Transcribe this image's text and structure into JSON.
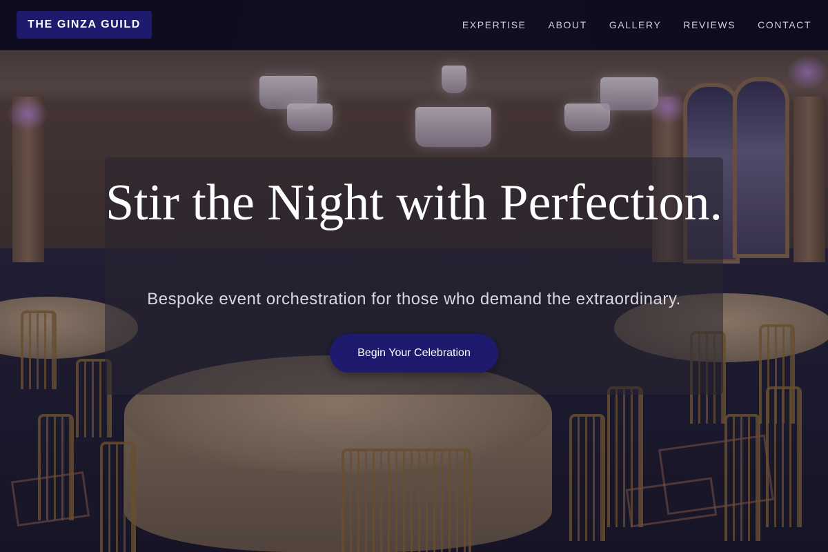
{
  "brand": {
    "name": "THE GINZA GUILD"
  },
  "nav": {
    "links": [
      {
        "label": "EXPERTISE"
      },
      {
        "label": "ABOUT"
      },
      {
        "label": "GALLERY"
      },
      {
        "label": "REVIEWS"
      },
      {
        "label": "CONTACT"
      }
    ]
  },
  "hero": {
    "title": "Stir the Night with Perfection.",
    "subtitle": "Bespoke event orchestration for those who demand the extraordinary.",
    "cta_label": "Begin Your Celebration",
    "background_image": "ballroom-with-chandeliers-and-round-tables"
  },
  "colors": {
    "brand_background": "#1e1b6e",
    "nav_background": "#0c0a1e",
    "nav_text": "#cfcfdc",
    "title_text": "#ffffff",
    "subtitle_text": "#d9d6de"
  }
}
